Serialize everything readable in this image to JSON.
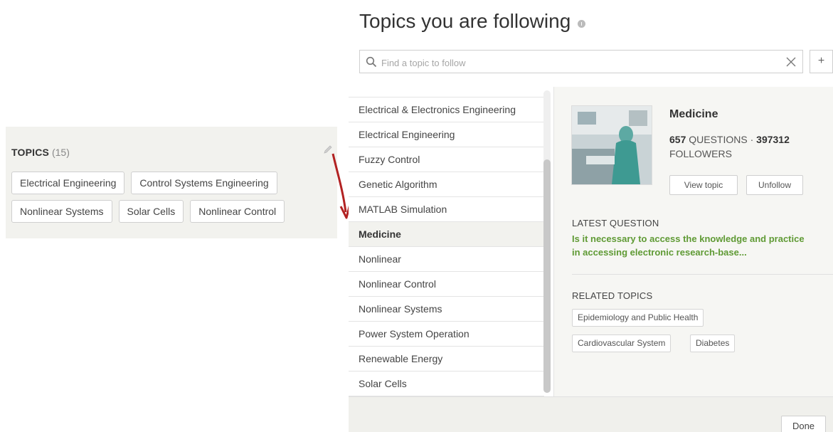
{
  "topics_panel": {
    "title": "TOPICS",
    "count": "(15)",
    "chips": [
      [
        "Electrical Engineering",
        "Control Systems Engineering"
      ],
      [
        "Nonlinear Systems",
        "Solar Cells",
        "Nonlinear Control"
      ]
    ]
  },
  "dialog": {
    "title": "Topics you are following",
    "search_placeholder": "Find a topic to follow",
    "add_label": "+",
    "list_items": [
      "Electrical & Electronics Engineering",
      "Electrical Engineering",
      "Fuzzy Control",
      "Genetic Algorithm",
      "MATLAB Simulation",
      "Medicine",
      "Nonlinear",
      "Nonlinear Control",
      "Nonlinear Systems",
      "Power System Operation",
      "Renewable Energy",
      "Solar Cells"
    ],
    "selected_index": 5,
    "detail": {
      "name": "Medicine",
      "questions_count": "657",
      "questions_label": "QUESTIONS ·",
      "followers_count": "397312",
      "followers_label": "FOLLOWERS",
      "view_topic_label": "View topic",
      "unfollow_label": "Unfollow",
      "latest_question_label": "LATEST QUESTION",
      "latest_question_line1": "Is it necessary to access the knowledge and practice",
      "latest_question_line2": "in accessing electronic research-base...",
      "related_topics_label": "RELATED TOPICS",
      "related_topics": [
        "Epidemiology and Public Health",
        "Cardiovascular System",
        "Diabetes"
      ]
    },
    "done_label": "Done"
  },
  "colors": {
    "panel_bg": "#f2f2ee",
    "question_green": "#5f9a34",
    "arrow_red": "#b22222"
  }
}
